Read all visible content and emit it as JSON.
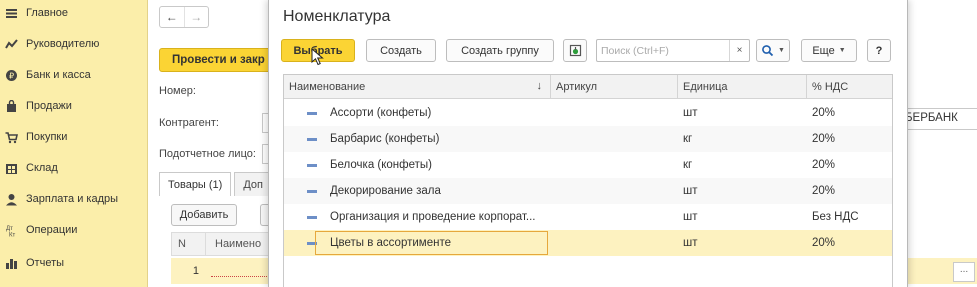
{
  "sidebar": {
    "items": [
      {
        "label": "Главное",
        "icon": "menu-lines-icon"
      },
      {
        "label": "Руководителю",
        "icon": "trend-icon"
      },
      {
        "label": "Банк и касса",
        "icon": "coin-icon"
      },
      {
        "label": "Продажи",
        "icon": "bag-icon"
      },
      {
        "label": "Покупки",
        "icon": "cart-icon"
      },
      {
        "label": "Склад",
        "icon": "warehouse-icon"
      },
      {
        "label": "Зарплата и кадры",
        "icon": "person-icon"
      },
      {
        "label": "Операции",
        "icon": "operations-icon"
      },
      {
        "label": "Отчеты",
        "icon": "bar-chart-icon"
      }
    ]
  },
  "document": {
    "back_arrow": "←",
    "forward_arrow": "→",
    "post_button": "Провести и закр",
    "number_label": "Номер:",
    "counterparty_label": "Контрагент:",
    "accountable_label": "Подотчетное лицо:",
    "tabs": [
      "Товары (1)",
      "Доп"
    ],
    "add_button": "Добавить",
    "grid_columns": [
      "N",
      "Наимено"
    ],
    "grid_row_number": "1",
    "right_value": "БЕРБАНК",
    "right_dots": "..."
  },
  "modal": {
    "title": "Номенклатура",
    "toolbar": {
      "select_button": "Выбрать",
      "create_button": "Создать",
      "create_group_button": "Создать группу",
      "search_placeholder": "Поиск (Ctrl+F)",
      "clear_search": "×",
      "more_button": "Еще",
      "help_button": "?"
    },
    "table": {
      "columns": [
        "Наименование",
        "Артикул",
        "Единица",
        "% НДС"
      ],
      "sort_indicator": "↓",
      "rows": [
        {
          "name": "Ассорти (конфеты)",
          "sku": "",
          "unit": "шт",
          "vat": "20%"
        },
        {
          "name": "Барбарис (конфеты)",
          "sku": "",
          "unit": "кг",
          "vat": "20%"
        },
        {
          "name": "Белочка (конфеты)",
          "sku": "",
          "unit": "кг",
          "vat": "20%"
        },
        {
          "name": "Декорирование зала",
          "sku": "",
          "unit": "шт",
          "vat": "20%"
        },
        {
          "name": "Организация и проведение корпорат...",
          "sku": "",
          "unit": "шт",
          "vat": "Без НДС"
        },
        {
          "name": "Цветы в ассортименте",
          "sku": "",
          "unit": "шт",
          "vat": "20%"
        }
      ]
    }
  },
  "colors": {
    "sidebar_bg": "#fbeeaa",
    "primary_button": "#fbd434",
    "selection_row": "#fdf2c0",
    "selection_border": "#e6a83c",
    "item_dash": "#6d8fc7"
  }
}
